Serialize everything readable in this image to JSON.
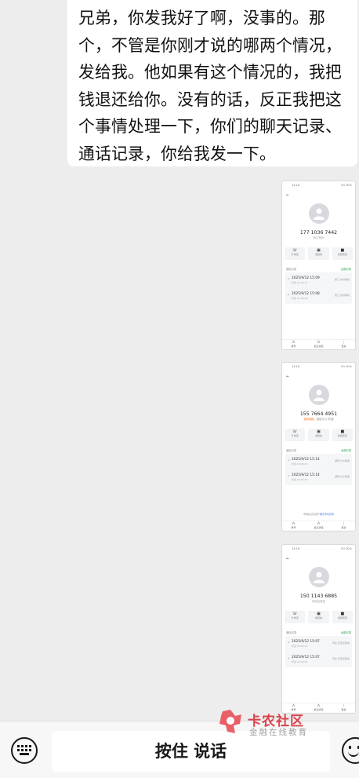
{
  "message": {
    "text": "兄弟，你发我好了啊，没事的。那个，不管是你刚才说的哪两个情况，发给我。他如果有这个情况的，我把钱退还给你。没有的话，反正我把这个事情处理一下，你们的聊天记录、通话记录，你给我发一下。"
  },
  "screenshots": [
    {
      "number": "177 1036 7442",
      "sub": "浙江杭州",
      "tag": "",
      "records": [
        {
          "time": "2025/9/12 15:09",
          "detail": "呼出 00:00:12",
          "right": "浙江 杭州移动"
        },
        {
          "time": "2025/9/12 15:08",
          "detail": "呼出 00:00:08",
          "right": "浙江 杭州移动"
        }
      ],
      "footnote": ""
    },
    {
      "number": "155 7664 4951",
      "sub": "湖南长沙 联通",
      "tag": "疑似骚扰",
      "records": [
        {
          "time": "2025/9/12 15:14",
          "detail": "呼出 00:00:21",
          "right": "湖南 长沙联通"
        },
        {
          "time": "2025/9/12 15:14",
          "detail": "呼出 00:00:05",
          "right": "湖南 长沙联通"
        }
      ],
      "footnote": "号码标记来源于",
      "footnote_link": "腾讯手机管家"
    },
    {
      "number": "150 1143 6885",
      "sub": "河北石家庄",
      "tag": "",
      "records": [
        {
          "time": "2025/9/12 15:07",
          "detail": "呼出 00:00:14",
          "right": "河北 石家庄移动"
        },
        {
          "time": "2025/9/12 15:07",
          "detail": "呼出 00:00:06",
          "right": "河北 石家庄移动"
        }
      ],
      "footnote": ""
    }
  ],
  "thumb": {
    "status_left": "14:16",
    "status_right": "5G 90%",
    "actions": [
      "打电话",
      "发短信",
      "视频通话"
    ],
    "section": "通话记录",
    "section_right": "全部记录",
    "nav": [
      "拨号",
      "最近通话",
      "更多"
    ]
  },
  "bottom_bar": {
    "hold_to_talk": "按住 说话",
    "keyboard_icon": "keyboard-icon",
    "emoji_icon": "emoji-icon"
  },
  "watermark": {
    "brand": "卡农社区",
    "slogan": "金融在线教育"
  },
  "colors": {
    "background": "#ededed",
    "bubble": "#ffffff",
    "watermark_red": "#d9303a"
  }
}
